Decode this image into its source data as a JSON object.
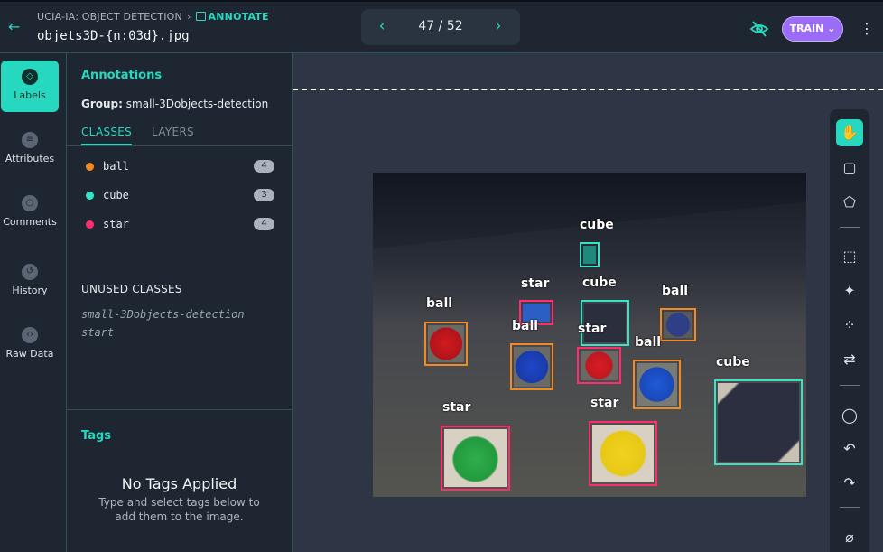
{
  "header": {
    "breadcrumb_project": "UCIA-IA: OBJECT DETECTION",
    "breadcrumb_mode": "ANNOTATE",
    "filename": "objets3D-{n:03d}.jpg",
    "pager": "47 / 52",
    "train_label": "TRAIN"
  },
  "leftnav": {
    "items": [
      {
        "label": "Labels",
        "icon": "tag-icon"
      },
      {
        "label": "Attributes",
        "icon": "list-icon"
      },
      {
        "label": "Comments",
        "icon": "comment-icon"
      },
      {
        "label": "History",
        "icon": "history-icon"
      },
      {
        "label": "Raw Data",
        "icon": "code-icon"
      }
    ]
  },
  "panel": {
    "title": "Annotations",
    "group_label": "Group:",
    "group_value": "small-3Dobjects-detection",
    "tabs": [
      "CLASSES",
      "LAYERS"
    ],
    "classes": [
      {
        "name": "ball",
        "count": "4",
        "color": "#f08a24"
      },
      {
        "name": "cube",
        "count": "3",
        "color": "#35e4c6"
      },
      {
        "name": "star",
        "count": "4",
        "color": "#ff2d6e"
      }
    ],
    "unused_title": "UNUSED CLASSES",
    "unused": [
      "small-3Dobjects-detection",
      "start"
    ],
    "tags_title": "Tags",
    "no_tags_title": "No Tags Applied",
    "no_tags_sub": "Type and select tags below to add them to the image."
  },
  "annotations": [
    {
      "label": "cube"
    },
    {
      "label": "star"
    },
    {
      "label": "cube"
    },
    {
      "label": "ball"
    },
    {
      "label": "ball"
    },
    {
      "label": "ball"
    },
    {
      "label": "star"
    },
    {
      "label": "ball"
    },
    {
      "label": "cube"
    },
    {
      "label": "star"
    },
    {
      "label": "star"
    }
  ],
  "toolbar": {
    "tools": [
      "hand-icon",
      "bbox-icon",
      "polygon-icon",
      "magic-select-icon",
      "magic-wand-icon",
      "keypoints-icon",
      "swap-icon",
      "comment-icon",
      "undo-icon",
      "redo-icon",
      "hide-icon"
    ]
  }
}
